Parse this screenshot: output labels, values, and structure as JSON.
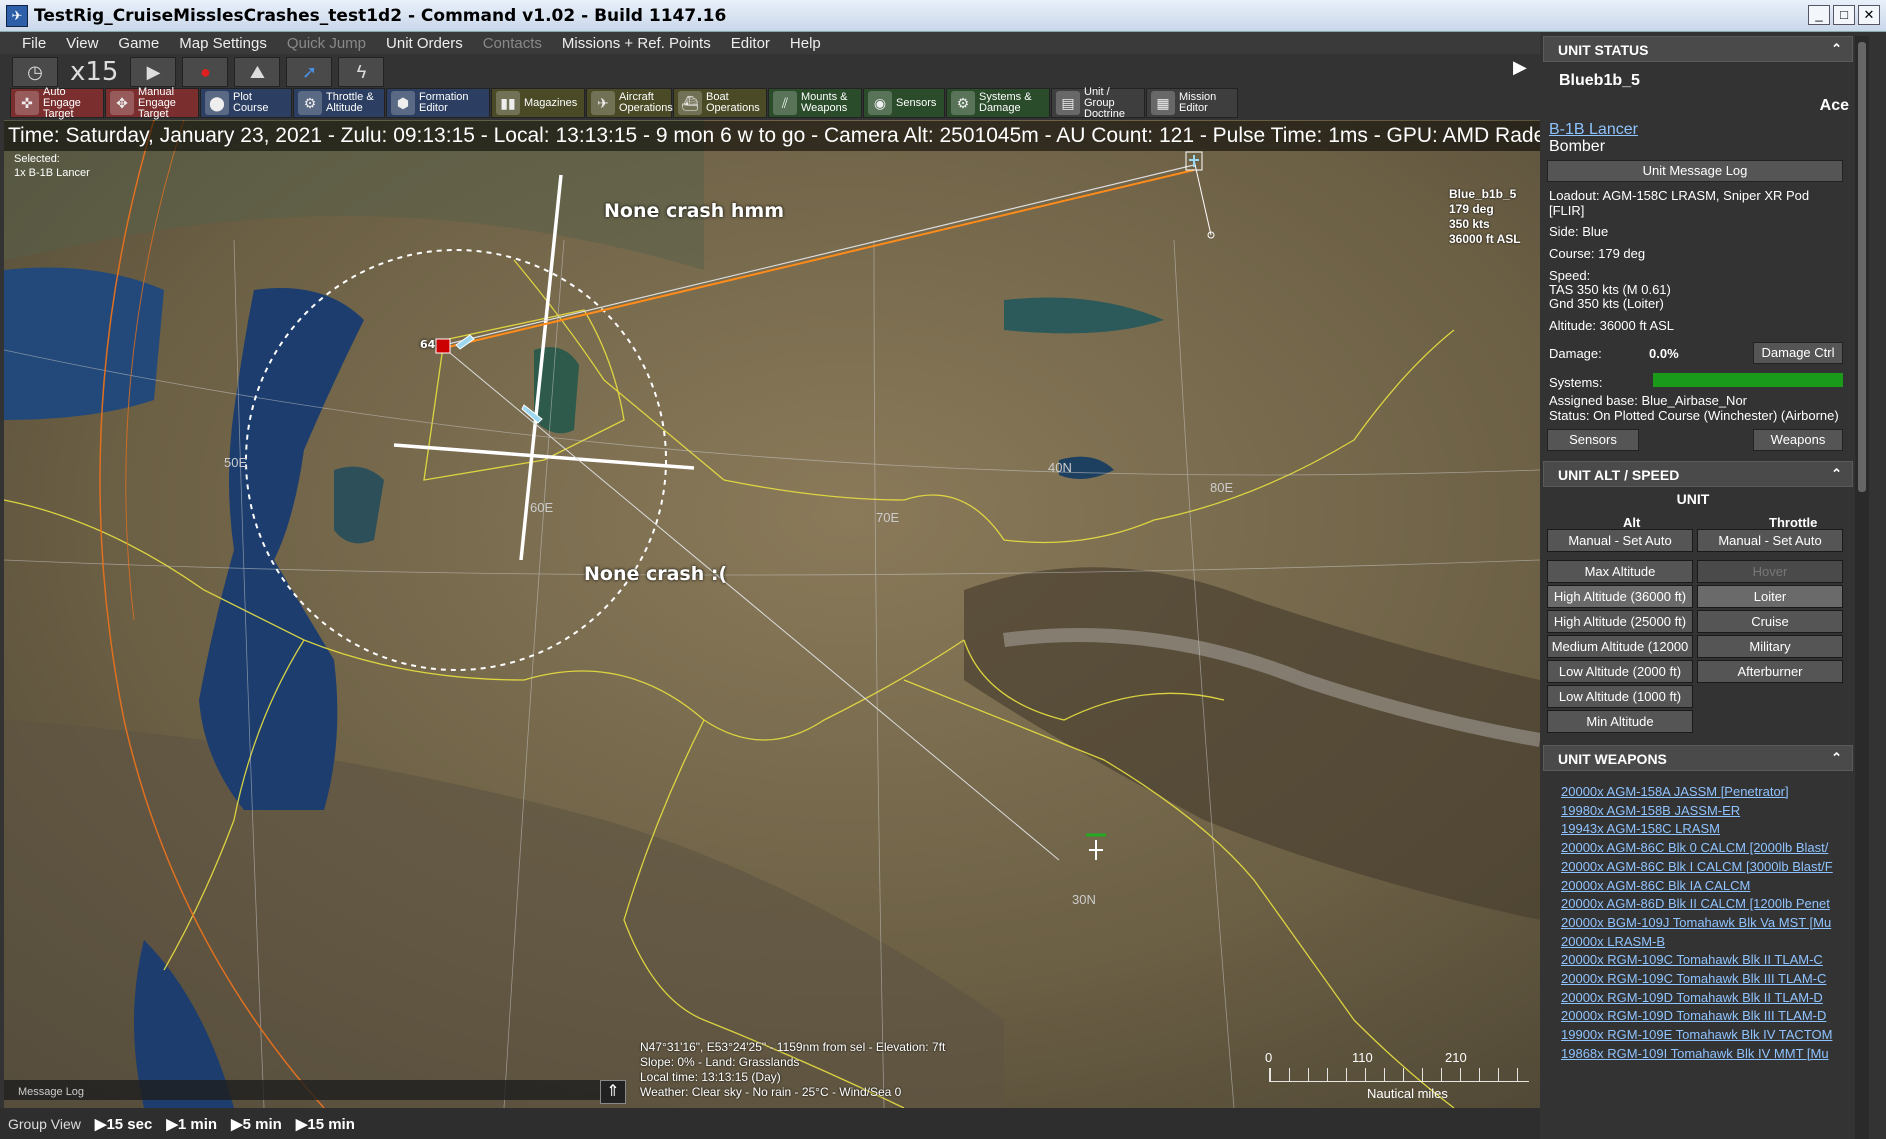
{
  "window": {
    "title": "TestRig_CruiseMisslesCrashes_test1d2 - Command v1.02 - Build 1147.16",
    "app_icon": "command-app-icon"
  },
  "menu": [
    {
      "label": "File",
      "disabled": false
    },
    {
      "label": "View",
      "disabled": false
    },
    {
      "label": "Game",
      "disabled": false
    },
    {
      "label": "Map Settings",
      "disabled": false
    },
    {
      "label": "Quick Jump",
      "disabled": true
    },
    {
      "label": "Unit Orders",
      "disabled": false
    },
    {
      "label": "Contacts",
      "disabled": true
    },
    {
      "label": "Missions + Ref. Points",
      "disabled": false
    },
    {
      "label": "Editor",
      "disabled": false
    },
    {
      "label": "Help",
      "disabled": false
    }
  ],
  "playbar": {
    "speed": "x15"
  },
  "toolbar": [
    {
      "label": "Auto Engage Target",
      "color": "red",
      "icon": "auto-engage-icon"
    },
    {
      "label": "Manual Engage Target",
      "color": "red",
      "icon": "manual-engage-icon"
    },
    {
      "label": "Plot Course",
      "color": "blue",
      "icon": "plot-course-icon"
    },
    {
      "label": "Throttle & Altitude",
      "color": "blue",
      "icon": "throttle-icon"
    },
    {
      "label": "Formation Editor",
      "color": "blue",
      "icon": "formation-icon"
    },
    {
      "label": "Magazines",
      "color": "olive",
      "icon": "magazines-icon"
    },
    {
      "label": "Aircraft Operations",
      "color": "olive",
      "icon": "aircraft-icon"
    },
    {
      "label": "Boat Operations",
      "color": "olive",
      "icon": "boat-icon"
    },
    {
      "label": "Mounts & Weapons",
      "color": "green",
      "icon": "mounts-icon"
    },
    {
      "label": "Sensors",
      "color": "green",
      "icon": "sensors-icon"
    },
    {
      "label": "Systems & Damage",
      "color": "green",
      "icon": "systems-icon"
    },
    {
      "label": "Unit / Group Doctrine",
      "color": "grey",
      "icon": "doctrine-icon"
    },
    {
      "label": "Mission Editor",
      "color": "grey",
      "icon": "mission-editor-icon"
    }
  ],
  "map": {
    "status_line": "Time: Saturday, January 23, 2021 - Zulu: 09:13:15 - Local: 13:13:15 - 9 mon 6 w to go -  Camera Alt: 2501045m  - AU Count: 121 - Pulse Time: 1ms - GPU: AMD Radeon",
    "selected_label": "Selected:",
    "selected_value": "1x B-1B Lancer",
    "annotation_top": "None crash hmm",
    "annotation_bottom": "None crash :(",
    "unit_label": {
      "name": "Blue_b1b_5",
      "course": "179 deg",
      "speed": "350 kts",
      "alt": "36000 ft ASL"
    },
    "base_number": "64",
    "grid_labels": {
      "e50": "50E",
      "e60": "60E",
      "e70": "70E",
      "e80": "80E",
      "n40": "40N",
      "n30": "30N"
    },
    "cursor_info": [
      "N47°31'16\", E53°24'25\" - 1159nm from sel - Elevation: 7ft",
      "Slope: 0%  - Land: Grasslands",
      "Local time: 13:13:15 (Day)",
      "Weather: Clear sky - No rain - 25°C - Wind/Sea 0"
    ],
    "scale": {
      "t0": "0",
      "t1": "110",
      "t2": "210",
      "units": "Nautical miles"
    },
    "message_log": "Message Log"
  },
  "bottombar": {
    "group_view": "Group View",
    "steps": [
      "15 sec",
      "1 min",
      "5 min",
      "15 min"
    ]
  },
  "unit_status": {
    "header": "UNIT STATUS",
    "name": "Blueb1b_5",
    "proficiency": "Ace",
    "class_link": "B-1B Lancer",
    "type": "Bomber",
    "message_log_btn": "Unit Message Log",
    "loadout": "Loadout: AGM-158C LRASM, Sniper XR Pod [FLIR]",
    "side": "Side: Blue",
    "course": "Course: 179 deg",
    "speed_label": "Speed:",
    "speed_tas": "TAS 350 kts (M 0.61)",
    "speed_gnd": "Gnd 350 kts (Loiter)",
    "altitude": "Altitude: 36000 ft ASL",
    "damage_label": "Damage:",
    "damage_value": "0.0%",
    "damage_btn": "Damage Ctrl",
    "systems_label": "Systems:",
    "systems_level": 1.0,
    "base": "Assigned base: Blue_Airbase_Nor",
    "status": "Status: On Plotted Course (Winchester) (Airborne)",
    "sensors_btn": "Sensors",
    "weapons_btn": "Weapons"
  },
  "alt_speed": {
    "header": "UNIT ALT / SPEED",
    "unit_label": "UNIT",
    "alt_hdr": "Alt",
    "throttle_hdr": "Throttle",
    "alt_auto": "Manual - Set Auto",
    "thr_auto": "Manual - Set Auto",
    "alt_options": [
      "Max Altitude",
      "High Altitude (36000 ft)",
      "High Altitude (25000 ft)",
      "Medium Altitude (12000",
      "Low Altitude (2000 ft)",
      "Low Altitude (1000 ft)",
      "Min Altitude"
    ],
    "throttle_options": [
      "Hover",
      "Loiter",
      "Cruise",
      "Military",
      "Afterburner"
    ]
  },
  "weapons": {
    "header": "UNIT WEAPONS",
    "items": [
      "20000x AGM-158A JASSM [Penetrator]",
      "19980x AGM-158B JASSM-ER",
      "19943x AGM-158C LRASM",
      "20000x AGM-86C Blk 0 CALCM [2000lb Blast/",
      "20000x AGM-86C Blk I CALCM [3000lb Blast/F",
      "20000x AGM-86C Blk IA CALCM",
      "20000x AGM-86D Blk II CALCM [1200lb Penet",
      "20000x BGM-109J Tomahawk Blk Va MST [Mu",
      "20000x LRASM-B",
      "20000x RGM-109C Tomahawk Blk II TLAM-C",
      "20000x RGM-109C Tomahawk Blk III TLAM-C",
      "20000x RGM-109D Tomahawk Blk II TLAM-D",
      "20000x RGM-109D Tomahawk Blk III TLAM-D",
      "19900x RGM-109E Tomahawk Blk IV TACTOM",
      "19868x RGM-109I Tomahawk Blk IV MMT [Mu"
    ]
  }
}
